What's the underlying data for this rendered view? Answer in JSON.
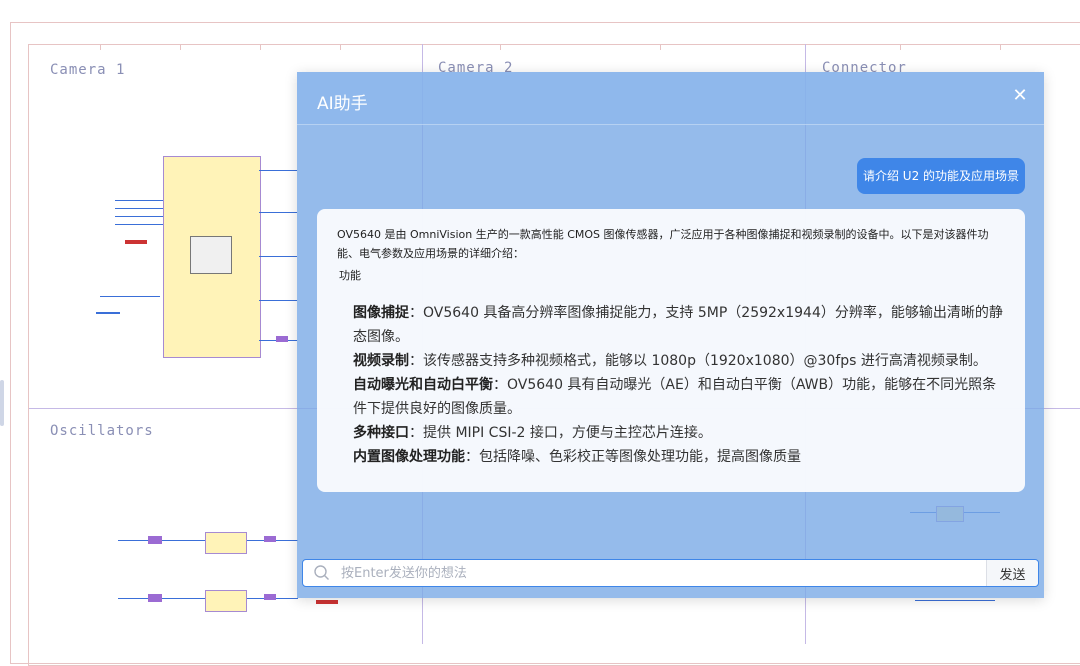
{
  "schematic": {
    "regions": [
      "Camera 1",
      "Camera 2",
      "Connector",
      "Oscillators"
    ]
  },
  "dialog": {
    "title": "AI助手",
    "close_icon": "close-icon",
    "user_message": "请介绍 U2 的功能及应用场景",
    "ai_intro": "OV5640 是由 OmniVision 生产的一款高性能 CMOS 图像传感器，广泛应用于各种图像捕捉和视频录制的设备中。以下是对该器件功能、电气参数及应用场景的详细介绍：",
    "section_heading": "功能",
    "features": [
      {
        "title": "图像捕捉",
        "text": "：OV5640 具备高分辨率图像捕捉能力，支持 5MP（2592x1944）分辨率，能够输出清晰的静态图像。"
      },
      {
        "title": "视频录制",
        "text": "：该传感器支持多种视频格式，能够以 1080p（1920x1080）@30fps 进行高清视频录制。"
      },
      {
        "title": "自动曝光和自动白平衡",
        "text": "：OV5640 具有自动曝光（AE）和自动白平衡（AWB）功能，能够在不同光照条件下提供良好的图像质量。"
      },
      {
        "title": "多种接口",
        "text": "：提供 MIPI CSI-2 接口，方便与主控芯片连接。"
      },
      {
        "title": "内置图像处理功能",
        "text": "：包括降噪、色彩校正等图像处理功能，提高图像质量"
      }
    ],
    "input_placeholder": "按Enter发送你的想法",
    "input_value": "",
    "send_label": "发送",
    "search_icon": "search-icon"
  },
  "colors": {
    "dialog_bg": "#7aaae6",
    "user_bubble": "#3f86e8",
    "grid_line": "#c5b9e6",
    "chip_fill": "#fff3b8"
  }
}
